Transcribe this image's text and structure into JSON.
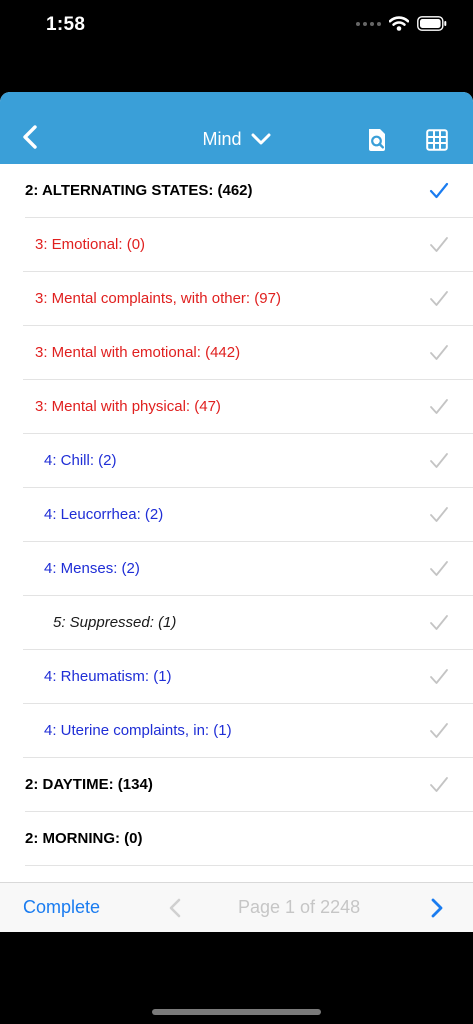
{
  "status_bar": {
    "time": "1:58"
  },
  "navbar": {
    "title": "Mind",
    "icons": [
      "chevron-left-icon",
      "chevron-down-icon",
      "search-document-icon",
      "grid-icon"
    ]
  },
  "rows": [
    {
      "text": "2: ALTERNATING STATES: (462)",
      "level": 2,
      "checked": true
    },
    {
      "text": "3: Emotional: (0)",
      "level": 3,
      "checked": false
    },
    {
      "text": "3: Mental complaints, with other: (97)",
      "level": 3,
      "checked": false
    },
    {
      "text": "3: Mental with emotional: (442)",
      "level": 3,
      "checked": false
    },
    {
      "text": "3: Mental with physical: (47)",
      "level": 3,
      "checked": false
    },
    {
      "text": "4: Chill: (2)",
      "level": 4,
      "checked": false
    },
    {
      "text": "4: Leucorrhea: (2)",
      "level": 4,
      "checked": false
    },
    {
      "text": "4: Menses: (2)",
      "level": 4,
      "checked": false
    },
    {
      "text": "5: Suppressed: (1)",
      "level": 5,
      "checked": false
    },
    {
      "text": "4: Rheumatism: (1)",
      "level": 4,
      "checked": false
    },
    {
      "text": "4: Uterine complaints, in: (1)",
      "level": 4,
      "checked": false
    },
    {
      "text": "2: DAYTIME: (134)",
      "level": 2,
      "checked": false
    },
    {
      "text": "2: MORNING: (0)",
      "level": 2,
      "checked": null
    }
  ],
  "toolbar": {
    "complete_label": "Complete",
    "page_label": "Page 1 of 2248"
  },
  "colors": {
    "navbar": "#3a9fd8",
    "level2": "#000000",
    "level3": "#e0201f",
    "level4": "#1f2ed6",
    "level5": "#1a1a1a",
    "check_active": "#1a7cf0",
    "check_inactive": "#c4c4c4",
    "toolbar_link": "#1a7cf0"
  }
}
